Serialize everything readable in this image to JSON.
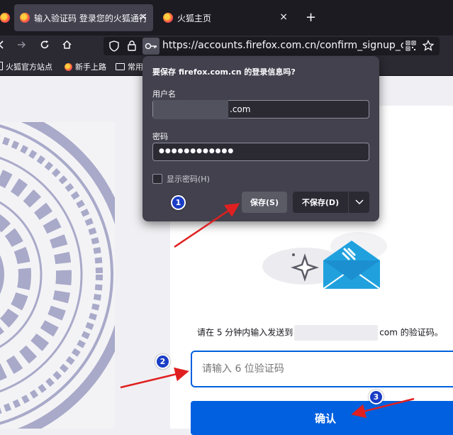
{
  "tabs": [
    {
      "title": "输入验证码 登录您的火狐通行证",
      "active": true
    },
    {
      "title": "火狐主页",
      "active": false
    }
  ],
  "tab_close_glyph": "×",
  "new_tab_glyph": "+",
  "url": {
    "main": "https://accounts.firefox.com.cn/confirm_signup_code?co",
    "host_bold": "firefox.com.cn"
  },
  "bookmarks": [
    "火狐官方站点",
    "新手上路",
    "常用"
  ],
  "popup": {
    "title": "要保存 firefox.com.cn 的登录信息吗?",
    "username_label": "用户名",
    "username_suffix": ".com",
    "password_label": "密码",
    "password_dots": "●●●●●●●●●●●●",
    "show_password_label": "显示密码(H)",
    "save_label": "保存(S)",
    "dont_save_label": "不保存(D)"
  },
  "page": {
    "instruction_before": "请在 5 分钟内输入发送到",
    "instruction_after": "com 的验证码。",
    "code_placeholder": "请输入 6 位验证码",
    "confirm_label": "确认"
  },
  "annotations": [
    "1",
    "2",
    "3"
  ],
  "colors": {
    "accent": "#0060df",
    "badge": "#1a3dc6",
    "arrow": "#e02020",
    "popup_bg": "#42414d",
    "chrome_bg": "#1c1b22"
  }
}
